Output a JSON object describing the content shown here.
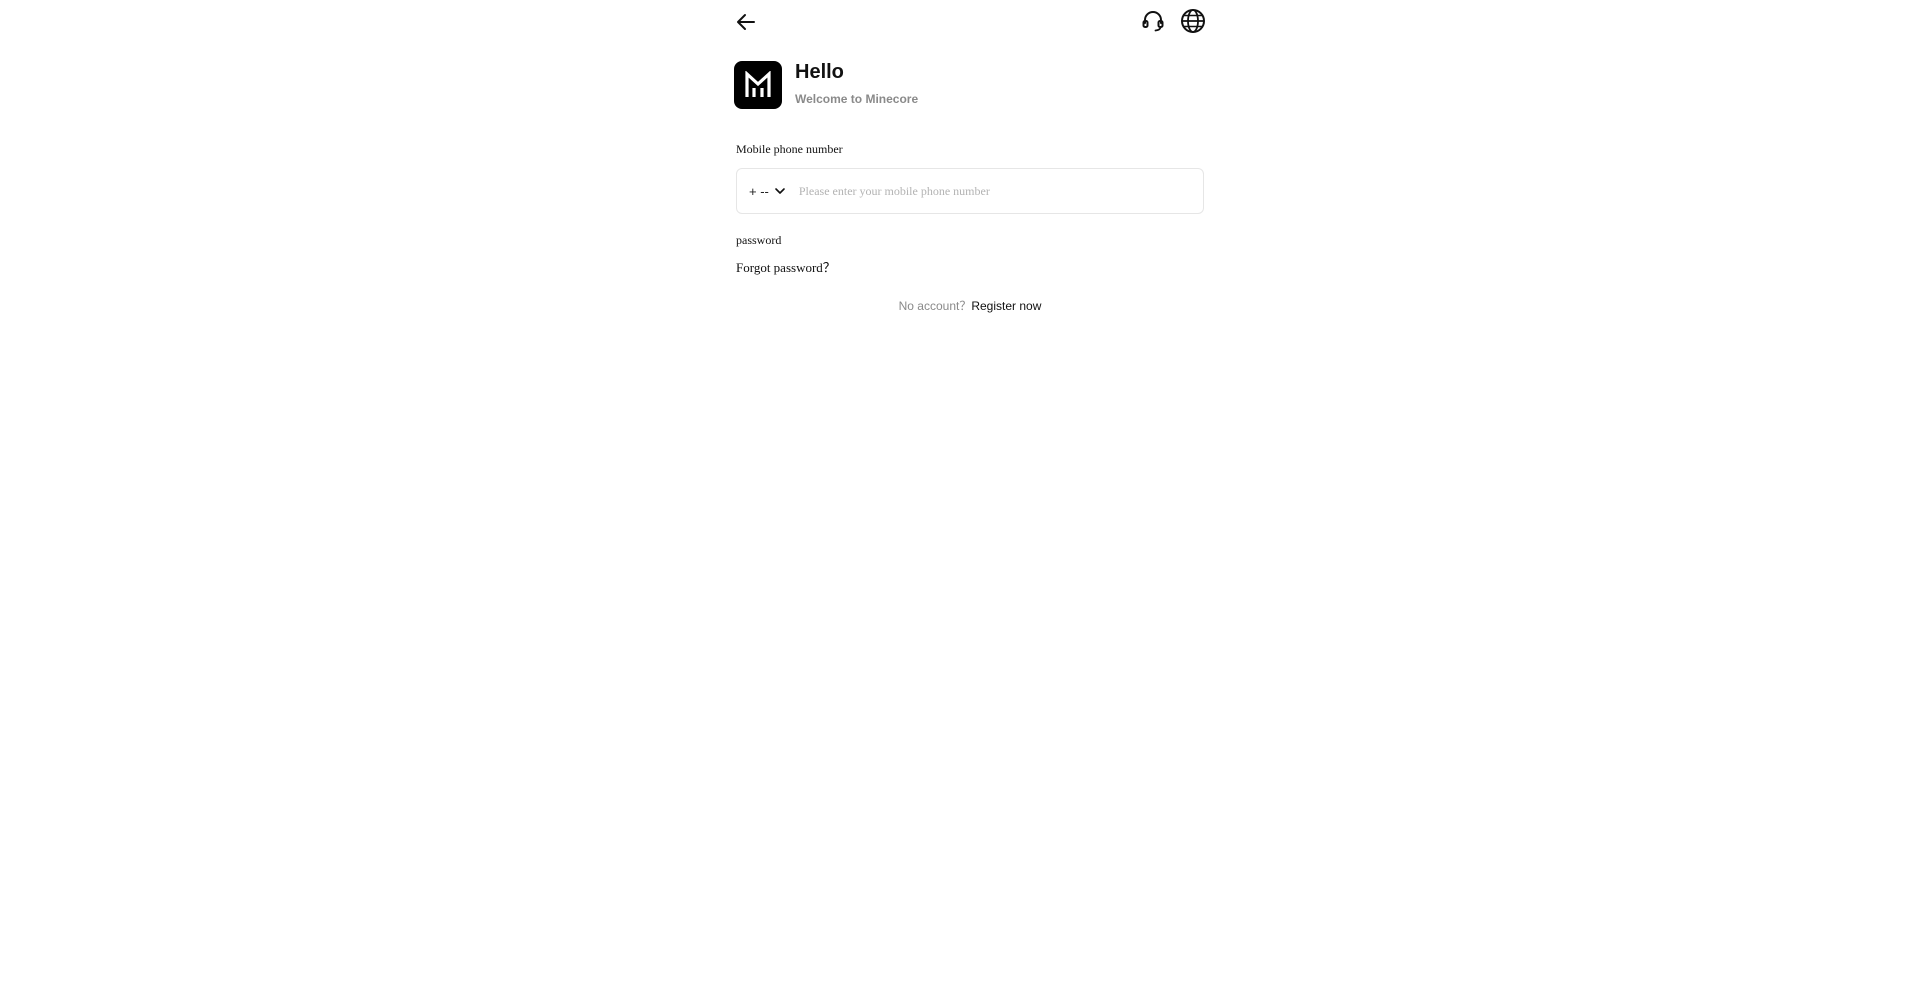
{
  "header": {
    "back_icon": "arrow-left-icon",
    "support_icon": "headset-icon",
    "language_icon": "globe-icon"
  },
  "brand": {
    "logo_icon": "minecore-logo",
    "greeting": "Hello",
    "welcome": "Welcome to Minecore",
    "logo_color": "#000000"
  },
  "form": {
    "phone_label": "Mobile phone number",
    "country_code": "+ --",
    "phone_value": "",
    "phone_placeholder": "Please enter your mobile phone number",
    "password_label": "password",
    "forgot_password": "Forgot password？"
  },
  "footer": {
    "no_account": "No account？",
    "register_now": "Register now"
  },
  "colors": {
    "text": "#111111",
    "muted": "#8a8a8a",
    "placeholder": "#b3b3b3",
    "border": "#e6e6e6"
  }
}
